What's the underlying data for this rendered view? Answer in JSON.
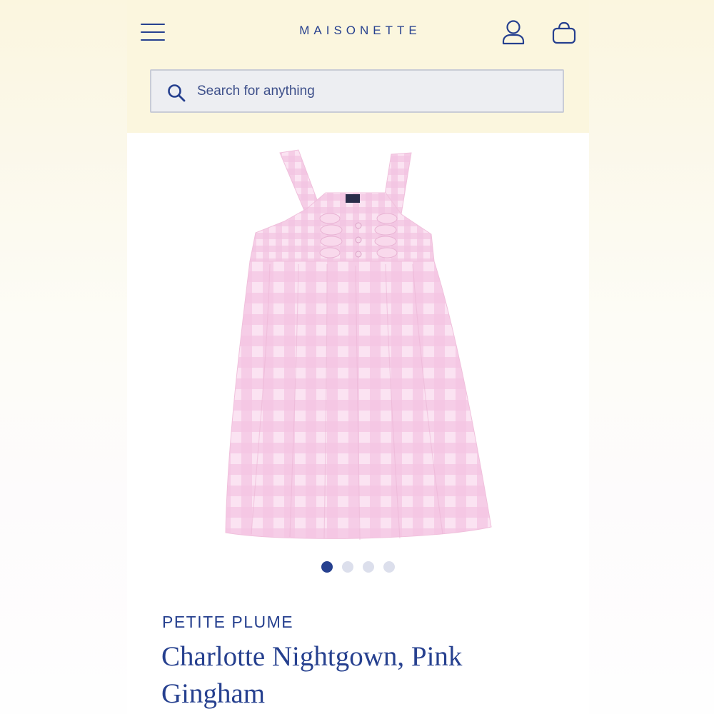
{
  "header": {
    "logo_text": "MAISONETTE",
    "menu_icon": "hamburger-menu-icon",
    "account_icon": "user-icon",
    "cart_icon": "shopping-bag-icon"
  },
  "search": {
    "placeholder": "Search for anything",
    "value": "",
    "icon": "search-icon"
  },
  "gallery": {
    "image_count": 4,
    "active_index": 0
  },
  "product": {
    "brand": "PETITE PLUME",
    "title": "Charlotte Nightgown, Pink Gingham"
  },
  "colors": {
    "brand_blue": "#26408f",
    "header_bg": "#fbf6de",
    "gingham_pink": "#f6c9e6"
  }
}
